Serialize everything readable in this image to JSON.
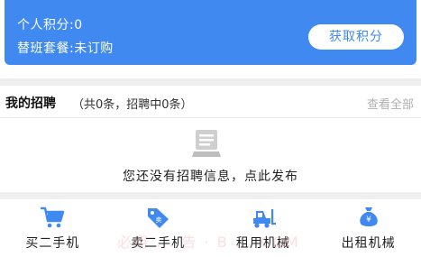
{
  "points": {
    "personal_points": "个人积分:0",
    "shift_package": "替班套餐:未订购",
    "get_points_button": "获取积分"
  },
  "recruit": {
    "title": "我的招聘",
    "count_text": "（共0条，招聘中0条）",
    "view_all": "查看全部",
    "empty_icon": "document-stack-icon",
    "empty_message": "您还没有招聘信息，点此发布"
  },
  "nav": [
    {
      "label": "买二手机",
      "icon": "shopping-cart-icon"
    },
    {
      "label": "卖二手机",
      "icon": "price-tag-icon"
    },
    {
      "label": "租用机械",
      "icon": "forklift-icon"
    },
    {
      "label": "出租机械",
      "icon": "money-bag-icon"
    }
  ],
  "watermark": "必用 ... 告 · B ... COM",
  "colors": {
    "primary": "#3f89f0",
    "background": "#ffffff",
    "separator": "#efefef",
    "muted_text": "#b0b0b0",
    "icon_gray": "#c8c8c8"
  }
}
